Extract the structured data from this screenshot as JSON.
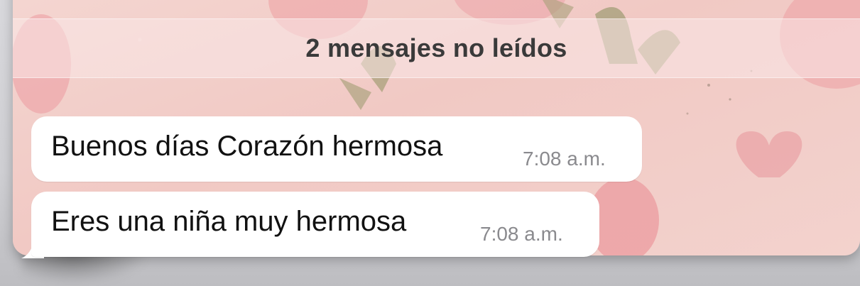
{
  "banner": {
    "unread_label": "2 mensajes no leídos"
  },
  "messages": [
    {
      "text": "Buenos días Corazón hermosa",
      "time": "7:08 a.m."
    },
    {
      "text": "Eres una niña muy hermosa",
      "time": "7:08 a.m."
    }
  ],
  "colors": {
    "bubble": "#ffffff",
    "wallpaper": "#f2cfcb",
    "time_text": "#8a8a8e",
    "message_text": "#111111"
  }
}
